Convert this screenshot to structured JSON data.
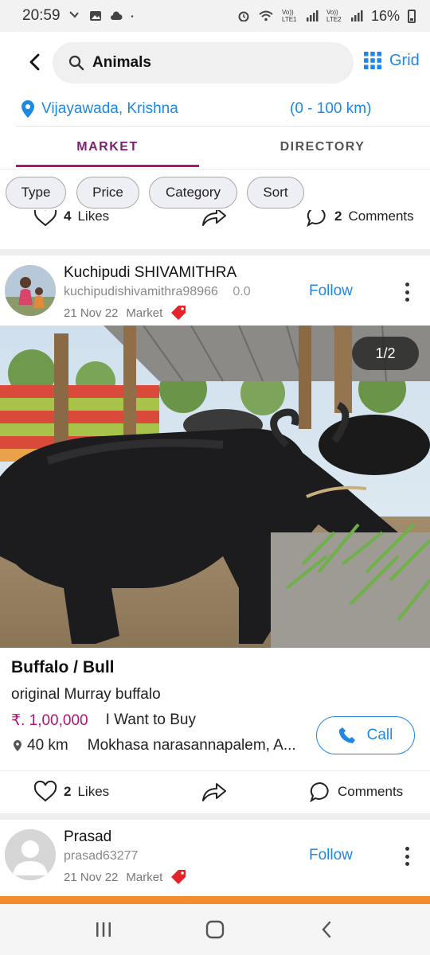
{
  "status_bar": {
    "time": "20:59",
    "battery": "16%",
    "signal1_label": "Vo)) LTE1",
    "signal2_label": "Vo)) LTE2"
  },
  "header": {
    "search_value": "Animals",
    "grid_label": "Grid"
  },
  "location": {
    "place": "Vijayawada, Krishna",
    "range": "(0 - 100 km)"
  },
  "tabs": [
    {
      "label": "MARKET",
      "active": true
    },
    {
      "label": "DIRECTORY",
      "active": false
    }
  ],
  "filters": [
    "Type",
    "Price",
    "Category",
    "Sort"
  ],
  "previous_post_actions": {
    "likes": "4",
    "likes_label": "Likes",
    "comments": "2",
    "comments_label": "Comments"
  },
  "post": {
    "user_name": "Kuchipudi SHIVAMITHRA",
    "user_handle": "kuchipudishivamithra98966",
    "rating": "0.0",
    "date": "21 Nov 22",
    "section": "Market",
    "follow_label": "Follow",
    "image_counter": "1/2",
    "title": "Buffalo / Bull",
    "description": "original Murray buffalo",
    "price": "₹. 1,00,000",
    "intent": "I Want to Buy",
    "distance": "40 km",
    "address": "Mokhasa narasannapalem, A...",
    "call_label": "Call",
    "likes": "2",
    "likes_label": "Likes",
    "comments_label": "Comments"
  },
  "next_post": {
    "user_name": "Prasad",
    "user_handle": "prasad63277",
    "date": "21 Nov 22",
    "section": "Market",
    "follow_label": "Follow"
  },
  "colors": {
    "accent_blue": "#1e88e5",
    "market_magenta": "#b0156f",
    "price_magenta": "#b0156f",
    "bottom_orange": "#f18b2c"
  },
  "icons": [
    "back-arrow-icon",
    "search-icon",
    "grid-icon",
    "location-pin-icon",
    "heart-icon",
    "share-icon",
    "comment-icon",
    "phone-icon",
    "tag-icon",
    "more-vertical-icon",
    "map-pin-icon"
  ]
}
